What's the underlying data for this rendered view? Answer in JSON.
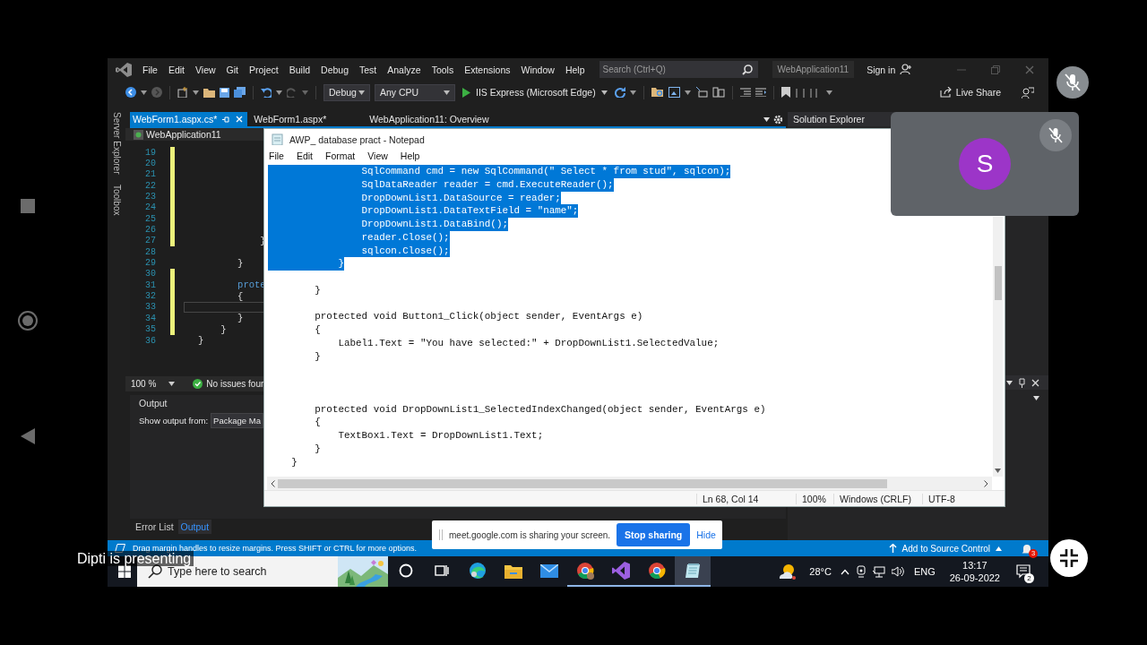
{
  "vs": {
    "menu": [
      "File",
      "Edit",
      "View",
      "Git",
      "Project",
      "Build",
      "Debug",
      "Test",
      "Analyze",
      "Tools",
      "Extensions",
      "Window",
      "Help"
    ],
    "search": {
      "placeholder": "Search (Ctrl+Q)"
    },
    "solution_name": "WebApplication11",
    "sign_in": "Sign in",
    "toolbar": {
      "configuration": "Debug",
      "platform": "Any CPU",
      "run_target": "IIS Express (Microsoft Edge)",
      "live_share": "Live Share"
    },
    "side_tabs": [
      "Server Explorer",
      "Toolbox"
    ],
    "doc_tabs": [
      {
        "label": "WebForm1.aspx.cs*",
        "selected": true
      },
      {
        "label": "WebForm1.aspx*",
        "selected": false
      },
      {
        "label": "WebApplication11: Overview",
        "selected": false
      }
    ],
    "nav_bar": "WebApplication11",
    "editor": {
      "lines": [
        {
          "number": "19",
          "kind": "empty",
          "changed": true,
          "current": false
        },
        {
          "number": "20",
          "kind": "empty",
          "changed": true,
          "current": false
        },
        {
          "number": "21",
          "kind": "empty",
          "changed": true,
          "current": false
        },
        {
          "number": "22",
          "kind": "empty",
          "changed": true,
          "current": false
        },
        {
          "number": "23",
          "kind": "empty",
          "changed": true,
          "current": false
        },
        {
          "number": "24",
          "kind": "empty",
          "changed": true,
          "current": false
        },
        {
          "number": "25",
          "kind": "empty",
          "changed": true,
          "current": false
        },
        {
          "number": "26",
          "kind": "empty",
          "changed": true,
          "current": false
        },
        {
          "number": "27",
          "kind": "plain",
          "changed": true,
          "current": false,
          "code": "           }"
        },
        {
          "number": "28",
          "kind": "empty",
          "changed": false,
          "current": false
        },
        {
          "number": "29",
          "kind": "plain",
          "changed": false,
          "current": false,
          "code": "       }"
        },
        {
          "number": "30",
          "kind": "empty",
          "changed": true,
          "current": false
        },
        {
          "number": "31",
          "kind": "keyword",
          "changed": true,
          "current": false,
          "code": "       prote"
        },
        {
          "number": "32",
          "kind": "plain",
          "changed": true,
          "current": false,
          "code": "       {"
        },
        {
          "number": "33",
          "kind": "empty",
          "changed": true,
          "current": true
        },
        {
          "number": "34",
          "kind": "plain",
          "changed": true,
          "current": false,
          "code": "       }"
        },
        {
          "number": "35",
          "kind": "plain",
          "changed": true,
          "current": false,
          "code": "    }"
        },
        {
          "number": "36",
          "kind": "plain",
          "changed": false,
          "current": false,
          "code": "}"
        }
      ]
    },
    "zoom": "100 %",
    "issues": "No issues foun",
    "solution_explorer": {
      "title": "Solution Explorer"
    },
    "output": {
      "title": "Output",
      "show_from_label": "Show output from:",
      "source": "Package Ma"
    },
    "bottom_tabs": [
      {
        "label": "Error List",
        "selected": false
      },
      {
        "label": "Output",
        "selected": true
      }
    ],
    "status_bar": {
      "message": "Drag margin handles to resize margins. Press SHIFT or CTRL for more options.",
      "source_control": "Add to Source Control",
      "notifications": "3"
    }
  },
  "notepad": {
    "title": "AWP_ database pract - Notepad",
    "menu": [
      "File",
      "Edit",
      "Format",
      "View",
      "Help"
    ],
    "lines": [
      {
        "kind": "code",
        "text": "                SqlCommand cmd = new SqlCommand(\" Select * from stud\", sqlcon);",
        "selected": true
      },
      {
        "kind": "code",
        "text": "                SqlDataReader reader = cmd.ExecuteReader();",
        "selected": true
      },
      {
        "kind": "code",
        "text": "                DropDownList1.DataSource = reader;",
        "selected": true
      },
      {
        "kind": "code",
        "text": "                DropDownList1.DataTextField = \"name\";",
        "selected": true
      },
      {
        "kind": "code",
        "text": "                DropDownList1.DataBind();",
        "selected": true
      },
      {
        "kind": "code",
        "text": "                reader.Close();",
        "selected": true
      },
      {
        "kind": "code",
        "text": "                sqlcon.Close();",
        "selected": true
      },
      {
        "kind": "code",
        "text": "            }",
        "selected": true
      },
      {
        "kind": "blank",
        "selected": false
      },
      {
        "kind": "code",
        "text": "        }",
        "selected": false
      },
      {
        "kind": "blank",
        "selected": false
      },
      {
        "kind": "code",
        "text": "        protected void Button1_Click(object sender, EventArgs e)",
        "selected": false
      },
      {
        "kind": "code",
        "text": "        {",
        "selected": false
      },
      {
        "kind": "code",
        "text": "            Label1.Text = \"You have selected:\" + DropDownList1.SelectedValue;",
        "selected": false
      },
      {
        "kind": "code",
        "text": "        }",
        "selected": false
      },
      {
        "kind": "blank",
        "selected": false
      },
      {
        "kind": "blank",
        "selected": false
      },
      {
        "kind": "blank",
        "selected": false
      },
      {
        "kind": "code",
        "text": "        protected void DropDownList1_SelectedIndexChanged(object sender, EventArgs e)",
        "selected": false
      },
      {
        "kind": "code",
        "text": "        {",
        "selected": false
      },
      {
        "kind": "code",
        "text": "            TextBox1.Text = DropDownList1.Text;",
        "selected": false
      },
      {
        "kind": "code",
        "text": "        }",
        "selected": false
      },
      {
        "kind": "code",
        "text": "    }",
        "selected": false
      }
    ],
    "status": {
      "position": "Ln 68, Col 14",
      "zoom": "100%",
      "line_endings": "Windows (CRLF)",
      "encoding": "UTF-8"
    }
  },
  "sharing_bar": {
    "message": "meet.google.com is sharing your screen.",
    "stop": "Stop sharing",
    "hide": "Hide"
  },
  "taskbar": {
    "search_placeholder": "Type here to search",
    "apps": [
      {
        "kind": "cortana",
        "running": false,
        "selected": false
      },
      {
        "kind": "task-view",
        "running": false,
        "selected": false
      },
      {
        "kind": "edge",
        "running": false,
        "selected": false
      },
      {
        "kind": "explorer",
        "running": false,
        "selected": false
      },
      {
        "kind": "mail",
        "running": false,
        "selected": false
      },
      {
        "kind": "chrome-profile",
        "running": true,
        "selected": false
      },
      {
        "kind": "visual-studio",
        "running": true,
        "selected": false
      },
      {
        "kind": "chrome",
        "running": true,
        "selected": false
      },
      {
        "kind": "notepad",
        "running": true,
        "selected": true
      }
    ],
    "temperature": "28°C",
    "language": "ENG",
    "time": "13:17",
    "date": "26-09-2022",
    "notification_count": "2"
  },
  "meet": {
    "presenter_caption": "Dipti is presenting",
    "participant_initial": "S"
  }
}
